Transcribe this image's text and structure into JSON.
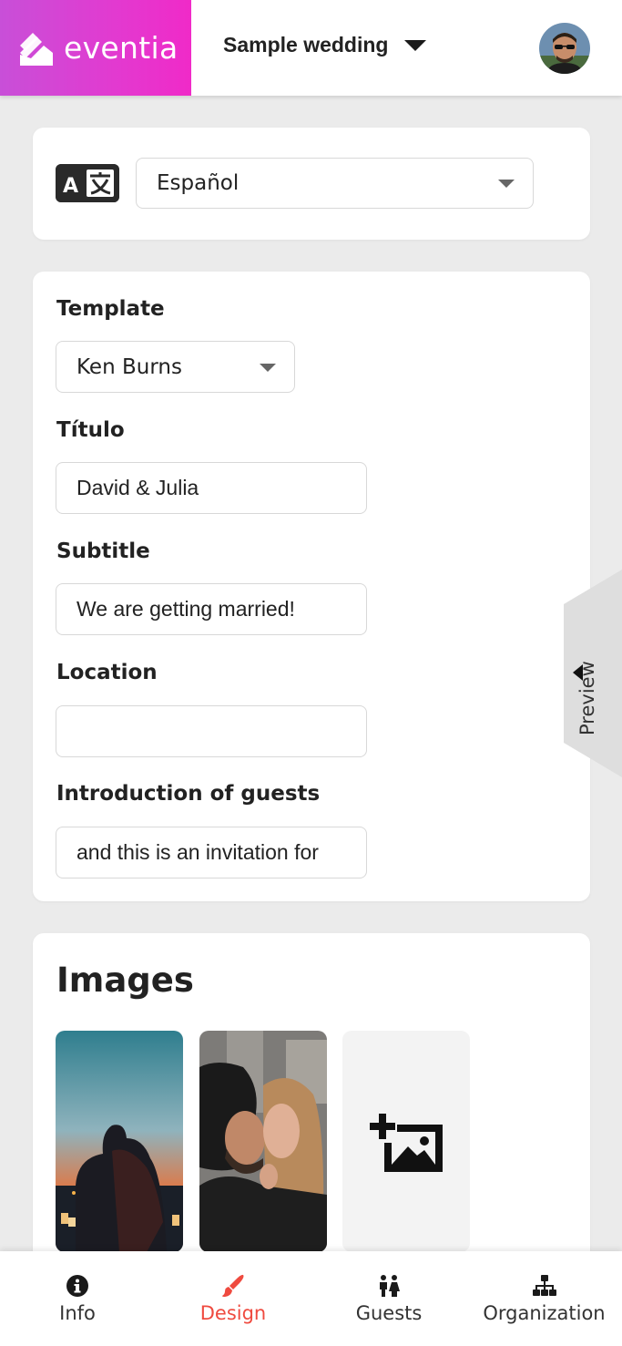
{
  "header": {
    "brand_name": "eventia",
    "event_name": "Sample wedding",
    "brand_gradient": [
      "#c84fd8",
      "#f02ac8"
    ]
  },
  "language": {
    "selected": "Español"
  },
  "form": {
    "template_label": "Template",
    "template_value": "Ken Burns",
    "title_label": "Título",
    "title_value": "David & Julia",
    "subtitle_label": "Subtitle",
    "subtitle_value": "We are getting married!",
    "location_label": "Location",
    "location_value": "",
    "intro_label": "Introduction of guests",
    "intro_value": "and this is an invitation for"
  },
  "images": {
    "title": "Images"
  },
  "preview": {
    "label": "Preview"
  },
  "nav": {
    "items": [
      {
        "label": "Info",
        "icon": "info-icon"
      },
      {
        "label": "Design",
        "icon": "brush-icon",
        "active": true
      },
      {
        "label": "Guests",
        "icon": "guests-icon"
      },
      {
        "label": "Organization",
        "icon": "organization-icon"
      }
    ],
    "active_color": "#ef4a3f"
  }
}
